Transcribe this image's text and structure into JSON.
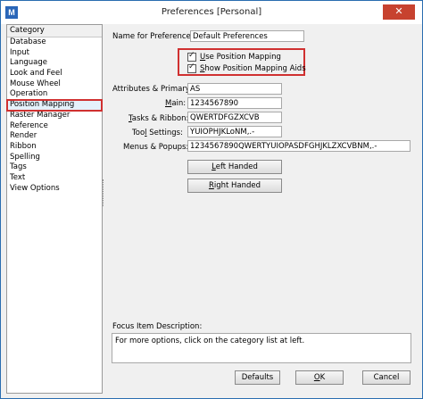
{
  "window": {
    "title": "Preferences [Personal]",
    "icon_name": "microstation-app-icon",
    "close_glyph": "✕"
  },
  "category": {
    "header": "Category",
    "items": [
      {
        "label": "Database"
      },
      {
        "label": "Input"
      },
      {
        "label": "Language"
      },
      {
        "label": "Look and Feel"
      },
      {
        "label": "Mouse Wheel"
      },
      {
        "label": "Operation"
      },
      {
        "label": "Position Mapping",
        "selected": true
      },
      {
        "label": "Raster Manager"
      },
      {
        "label": "Reference"
      },
      {
        "label": "Render"
      },
      {
        "label": "Ribbon"
      },
      {
        "label": "Spelling"
      },
      {
        "label": "Tags"
      },
      {
        "label": "Text"
      },
      {
        "label": "View Options"
      }
    ]
  },
  "main": {
    "name_label": "Name for Preferences:",
    "name_value": "Default Preferences",
    "use_position_mapping": {
      "label_u": "U",
      "label_rest": "se Position Mapping",
      "checked": true
    },
    "show_position_mapping_aids": {
      "label_u": "S",
      "label_rest": "how Position Mapping Aids",
      "checked": true
    },
    "attributes_label": "Attributes & Primary:",
    "attributes_value": "AS",
    "main_label_u": "M",
    "main_label_rest": "ain:",
    "main_value": "1234567890",
    "tasks_label_u": "T",
    "tasks_label_rest": "asks & Ribbon:",
    "tasks_value": "QWERTDFGZXCVB",
    "tool_label_pre": "Too",
    "tool_label_u": "l",
    "tool_label_rest": " Settings:",
    "tool_value": "YUIOPHJKLoNM,.-",
    "menus_label": "Menus & Popups:",
    "menus_value": "1234567890QWERTYUIOPASDFGHJKLZXCVBNM,.-",
    "left_handed_u": "L",
    "left_handed_rest": "eft Handed",
    "right_handed_u": "R",
    "right_handed_rest": "ight Handed",
    "focus_label": "Focus Item Description:",
    "focus_text": "For more options, click on the category list at left."
  },
  "footer": {
    "defaults_label": "Defaults",
    "ok_u": "O",
    "ok_rest": "K",
    "cancel_label": "Cancel"
  },
  "colors": {
    "highlight_red": "#d03030",
    "close_red": "#c7422f",
    "accent_blue": "#2a66b8"
  }
}
